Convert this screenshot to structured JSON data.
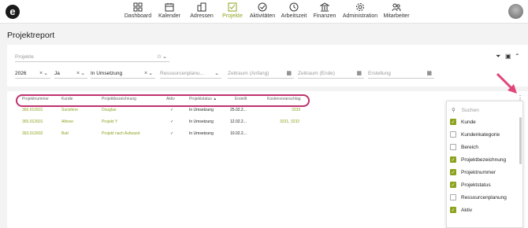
{
  "nav": [
    {
      "label": "Dashboard",
      "icon": "dashboard-icon"
    },
    {
      "label": "Kalender",
      "icon": "calendar-icon"
    },
    {
      "label": "Adressen",
      "icon": "buildings-icon"
    },
    {
      "label": "Projekte",
      "icon": "projects-icon",
      "active": true
    },
    {
      "label": "Aktivitäten",
      "icon": "activities-icon"
    },
    {
      "label": "Arbeitszeit",
      "icon": "clock-icon"
    },
    {
      "label": "Finanzen",
      "icon": "bank-icon"
    },
    {
      "label": "Administration",
      "icon": "gear-icon"
    },
    {
      "label": "Mitarbeiter",
      "icon": "users-icon"
    }
  ],
  "logo": "e",
  "page_title": "Projektreport",
  "filters": {
    "projekte_placeholder": "Projekte",
    "year": "2026",
    "ja": "Ja",
    "status": "In Umsetzung",
    "ressourcen_placeholder": "Ressourcenplanu...",
    "zeitraum_anfang": "Zeitraum (Anfang)",
    "zeitraum_ende": "Zeitraum (Ende)",
    "erstellung": "Erstellung"
  },
  "columns": [
    "Projektnummer",
    "Kunde",
    "Projektbezeichnung",
    "Aktiv",
    "Projektstatus ▲",
    "Erstellt",
    "Kostenvoranschlag"
  ],
  "rows": [
    {
      "nummer": "366.012601",
      "kunde": "Sunshine",
      "bez": "Douglas",
      "aktiv": "✓",
      "status": "In Umsetzung",
      "erstellt": "25.02.2...",
      "kosten": "3239"
    },
    {
      "nummer": "365.012601",
      "kunde": "Allnew",
      "bez": "Projekt Y",
      "aktiv": "✓",
      "status": "In Umsetzung",
      "erstellt": "12.02.2...",
      "kosten": "3231, 3232"
    },
    {
      "nummer": "363.012602",
      "kunde": "Butt",
      "bez": "Projekt nach Aufwand",
      "aktiv": "✓",
      "status": "In Umsetzung",
      "erstellt": "10.02.2...",
      "kosten": ""
    }
  ],
  "dropdown": {
    "search_placeholder": "Suchen",
    "items": [
      {
        "label": "Kunde",
        "checked": true
      },
      {
        "label": "Kundenkategorie",
        "checked": false
      },
      {
        "label": "Bereich",
        "checked": false
      },
      {
        "label": "Projektbezeichnung",
        "checked": true
      },
      {
        "label": "Projektnummer",
        "checked": true
      },
      {
        "label": "Projektstatus",
        "checked": true
      },
      {
        "label": "Ressourcenplanung",
        "checked": false
      },
      {
        "label": "Aktiv",
        "checked": true
      }
    ]
  },
  "colors": {
    "accent": "#8ea21f",
    "highlight": "#c0316e"
  }
}
